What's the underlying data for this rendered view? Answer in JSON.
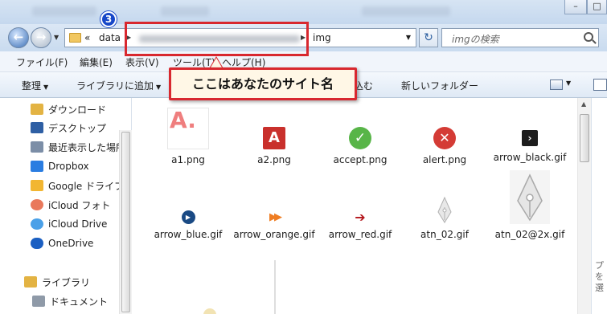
{
  "addressbar": {
    "history_arrow": "«",
    "crumb1": "data",
    "crumb3": "img",
    "search_placeholder": "imgの検索"
  },
  "menu": [
    "ファイル(F)",
    "編集(E)",
    "表示(V)",
    "ツール(T)",
    "ヘルプ(H)"
  ],
  "toolbar": {
    "organize": "整理",
    "add_to_library": "ライブラリに追加",
    "partial_item": "込む",
    "new_folder": "新しいフォルダー"
  },
  "nav": {
    "favorites": [
      {
        "label": "ダウンロード",
        "icon": "download-folder-icon",
        "color": "#e3b343"
      },
      {
        "label": "デスクトップ",
        "icon": "desktop-icon",
        "color": "#2e5fa4"
      },
      {
        "label": "最近表示した場所",
        "icon": "recent-places-icon",
        "color": "#7c8ea7"
      },
      {
        "label": "Dropbox",
        "icon": "dropbox-icon",
        "color": "#2a7de1"
      },
      {
        "label": "Google ドライブ",
        "icon": "google-drive-icon",
        "color": "#f2b632"
      },
      {
        "label": "iCloud フォト",
        "icon": "icloud-photos-icon",
        "color": "#e9795c"
      },
      {
        "label": "iCloud Drive",
        "icon": "icloud-drive-icon",
        "color": "#4aa0e8"
      },
      {
        "label": "OneDrive",
        "icon": "onedrive-icon",
        "color": "#1b5fc2"
      }
    ],
    "libraries": [
      {
        "label": "ライブラリ",
        "icon": "libraries-icon",
        "color": "#e3b343"
      },
      {
        "label": "ドキュメント",
        "icon": "documents-icon",
        "color": "#8f9aa8"
      }
    ]
  },
  "files": [
    {
      "name": "a1.png",
      "icon": "letter-a-pink-icon"
    },
    {
      "name": "a2.png",
      "icon": "letter-a-red-icon"
    },
    {
      "name": "accept.png",
      "icon": "green-check-icon"
    },
    {
      "name": "alert.png",
      "icon": "red-x-icon"
    },
    {
      "name": "arrow_black.gif",
      "icon": "black-arrow-icon"
    },
    {
      "name": "arrow_blue.gif",
      "icon": "blue-play-icon"
    },
    {
      "name": "arrow_orange.gif",
      "icon": "orange-double-arrow-icon"
    },
    {
      "name": "arrow_red.gif",
      "icon": "red-arrow-icon"
    },
    {
      "name": "atn_02.gif",
      "icon": "pen-nib-small-icon"
    },
    {
      "name": "atn_02@2x.gif",
      "icon": "pen-nib-large-icon"
    }
  ],
  "preview_text": "プ\nを\n選",
  "annotation": {
    "step_number": "3",
    "callout_text": "ここはあなたのサイト名"
  },
  "colors": {
    "highlight_red": "#d8282f",
    "callout_bg": "#fff7e6",
    "badge_blue": "#1747c8"
  }
}
